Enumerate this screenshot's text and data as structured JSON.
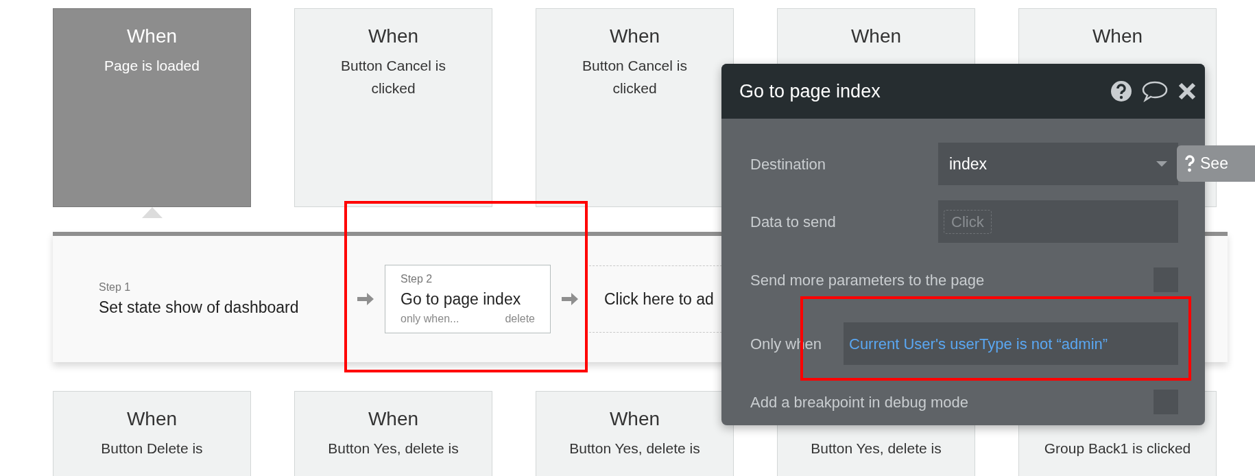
{
  "top_cards": [
    {
      "title": "When",
      "description": "Page is loaded",
      "selected": true
    },
    {
      "title": "When",
      "description": "Button Cancel is clicked",
      "selected": false
    },
    {
      "title": "When",
      "description": "Button Cancel is clicked",
      "selected": false
    },
    {
      "title": "When",
      "selected": false
    },
    {
      "title": "When",
      "selected": false
    }
  ],
  "workflow": {
    "steps": [
      {
        "label": "Step 1",
        "action": "Set state show of dashboard",
        "selected": false
      },
      {
        "label": "Step 2",
        "action": "Go to page index",
        "selected": true,
        "condition_link": "only when...",
        "delete_link": "delete"
      }
    ],
    "add_step": "Click here to ad"
  },
  "bottom_cards": [
    {
      "title": "When",
      "description": "Button Delete is",
      "selected": false
    },
    {
      "title": "When",
      "description": "Button Yes, delete is",
      "selected": false
    },
    {
      "title": "When",
      "description": "Button Yes, delete is",
      "selected": false
    },
    {
      "description": "Button Yes, delete is",
      "selected": false
    },
    {
      "description": "Group Back1 is clicked",
      "selected": false
    }
  ],
  "popup": {
    "title": "Go to page index",
    "side_button": "See",
    "fields": [
      {
        "kind": "dropdown",
        "label": "Destination",
        "value": "index"
      },
      {
        "kind": "dynamic",
        "label": "Data to send",
        "placeholder": "Click"
      },
      {
        "kind": "checkbox",
        "label": "Send more parameters to the page",
        "checked": false
      },
      {
        "kind": "expression",
        "label": "Only when",
        "value": "Current User's userType is not “admin”"
      },
      {
        "kind": "checkbox",
        "label": "Add a breakpoint in debug mode",
        "checked": false
      }
    ]
  }
}
